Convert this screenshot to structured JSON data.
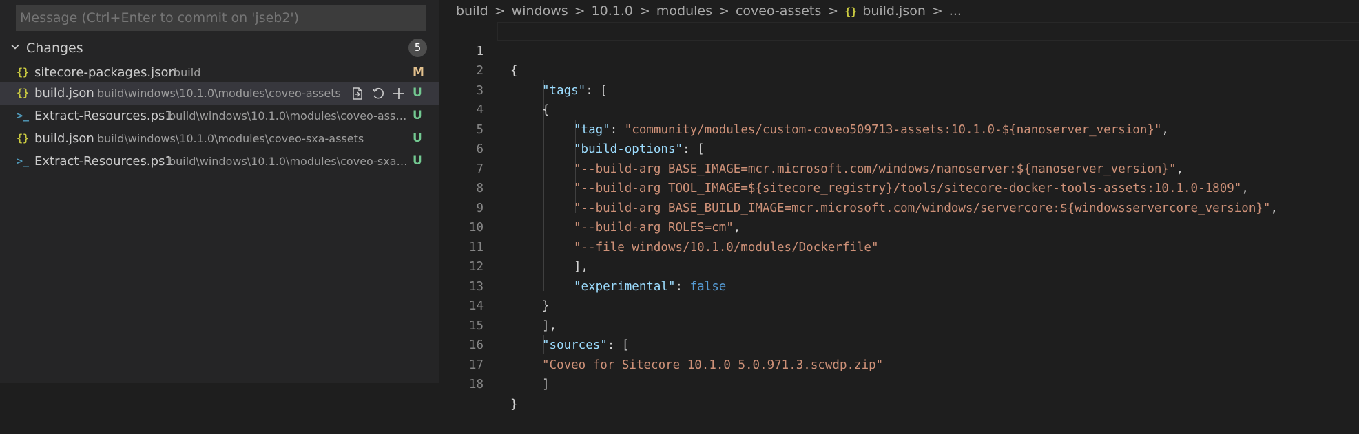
{
  "scm": {
    "commit_placeholder": "Message (Ctrl+Enter to commit on 'jseb2')",
    "changes_label": "Changes",
    "changes_count": "5",
    "files": [
      {
        "icon": "json-braces-icon",
        "name": "sitecore-packages.json",
        "path": "build",
        "status": "M"
      },
      {
        "icon": "json-braces-icon",
        "name": "build.json",
        "path": "build\\windows\\10.1.0\\modules\\coveo-assets",
        "status": "U"
      },
      {
        "icon": "powershell-icon",
        "name": "Extract-Resources.ps1",
        "path": "build\\windows\\10.1.0\\modules\\coveo-asse...",
        "status": "U"
      },
      {
        "icon": "json-braces-icon",
        "name": "build.json",
        "path": "build\\windows\\10.1.0\\modules\\coveo-sxa-assets",
        "status": "U"
      },
      {
        "icon": "powershell-icon",
        "name": "Extract-Resources.ps1",
        "path": "build\\windows\\10.1.0\\modules\\coveo-sxa-...",
        "status": "U"
      }
    ]
  },
  "editor": {
    "breadcrumb": [
      "build",
      "windows",
      "10.1.0",
      "modules",
      "coveo-assets",
      "build.json",
      "..."
    ],
    "line_numbers": [
      "1",
      "2",
      "3",
      "4",
      "5",
      "6",
      "7",
      "8",
      "9",
      "10",
      "11",
      "12",
      "13",
      "14",
      "15",
      "16",
      "17",
      "18"
    ],
    "code": {
      "l1": "{",
      "l2_key": "\"tags\"",
      "l2_rest": ": [",
      "l3": "{",
      "l4_key": "\"tag\"",
      "l4_colon": ": ",
      "l4_val": "\"community/modules/custom-coveo509713-assets:10.1.0-${nanoserver_version}\"",
      "l4_end": ",",
      "l5_key": "\"build-options\"",
      "l5_rest": ": [",
      "l6_val": "\"--build-arg BASE_IMAGE=mcr.microsoft.com/windows/nanoserver:${nanoserver_version}\"",
      "l6_end": ",",
      "l7_val": "\"--build-arg TOOL_IMAGE=${sitecore_registry}/tools/sitecore-docker-tools-assets:10.1.0-1809\"",
      "l7_end": ",",
      "l8_val": "\"--build-arg BASE_BUILD_IMAGE=mcr.microsoft.com/windows/servercore:${windowsservercore_version}\"",
      "l8_end": ",",
      "l9_val": "\"--build-arg ROLES=cm\"",
      "l9_end": ",",
      "l10_val": "\"--file windows/10.1.0/modules/Dockerfile\"",
      "l11": "],",
      "l12_key": "\"experimental\"",
      "l12_colon": ": ",
      "l12_val": "false",
      "l13": "}",
      "l14": "],",
      "l15_key": "\"sources\"",
      "l15_rest": ": [",
      "l16_val": "\"Coveo for Sitecore 10.1.0 5.0.971.3.scwdp.zip\"",
      "l17": "]",
      "l18": "}"
    }
  },
  "colors": {
    "key": "#9cdcfe",
    "string": "#ce9178",
    "boolean": "#569cd6",
    "modified": "#e2c08d",
    "untracked": "#73c991"
  }
}
